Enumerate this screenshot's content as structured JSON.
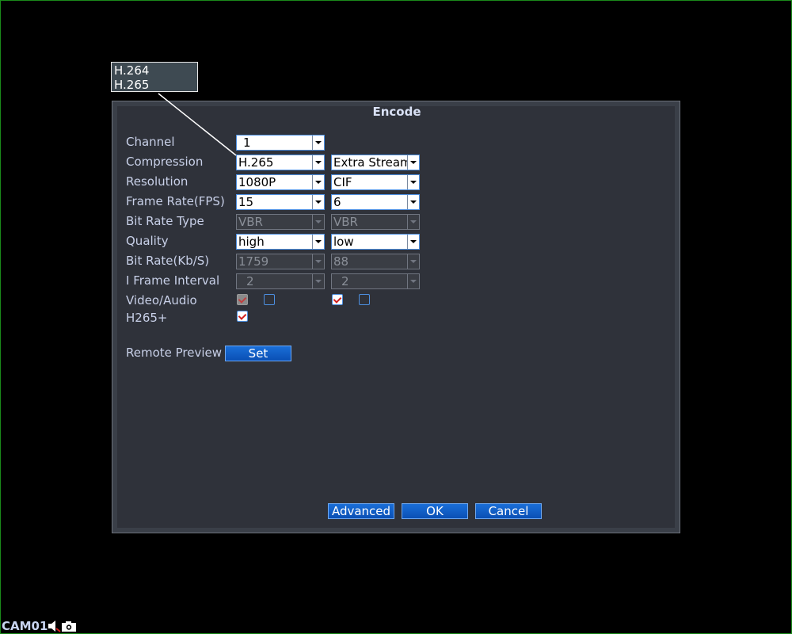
{
  "popup": {
    "options": [
      "H.264",
      "H.265"
    ]
  },
  "dialog": {
    "title": "Encode",
    "labels": {
      "channel": "Channel",
      "compression": "Compression",
      "resolution": "Resolution",
      "frame_rate": "Frame Rate(FPS)",
      "bit_rate_type": "Bit Rate Type",
      "quality": "Quality",
      "bit_rate": "Bit Rate(Kb/S)",
      "i_frame": "I Frame Interval",
      "video_audio": "Video/Audio",
      "h265plus": "H265+",
      "remote_preview": "Remote Preview"
    },
    "main_stream": {
      "channel": "1",
      "compression": "H.265",
      "resolution": "1080P",
      "frame_rate": "15",
      "bit_rate_type": "VBR",
      "quality": "high",
      "bit_rate": "1759",
      "i_frame": "2",
      "video": true,
      "audio": false,
      "h265plus": true
    },
    "extra_stream": {
      "stream": "Extra Stream",
      "resolution": "CIF",
      "frame_rate": "6",
      "bit_rate_type": "VBR",
      "quality": "low",
      "bit_rate": "88",
      "i_frame": "2",
      "video": true,
      "audio": false
    },
    "buttons": {
      "set": "Set",
      "advanced": "Advanced",
      "ok": "OK",
      "cancel": "Cancel"
    }
  },
  "status_bar": {
    "camera": "CAM01"
  }
}
